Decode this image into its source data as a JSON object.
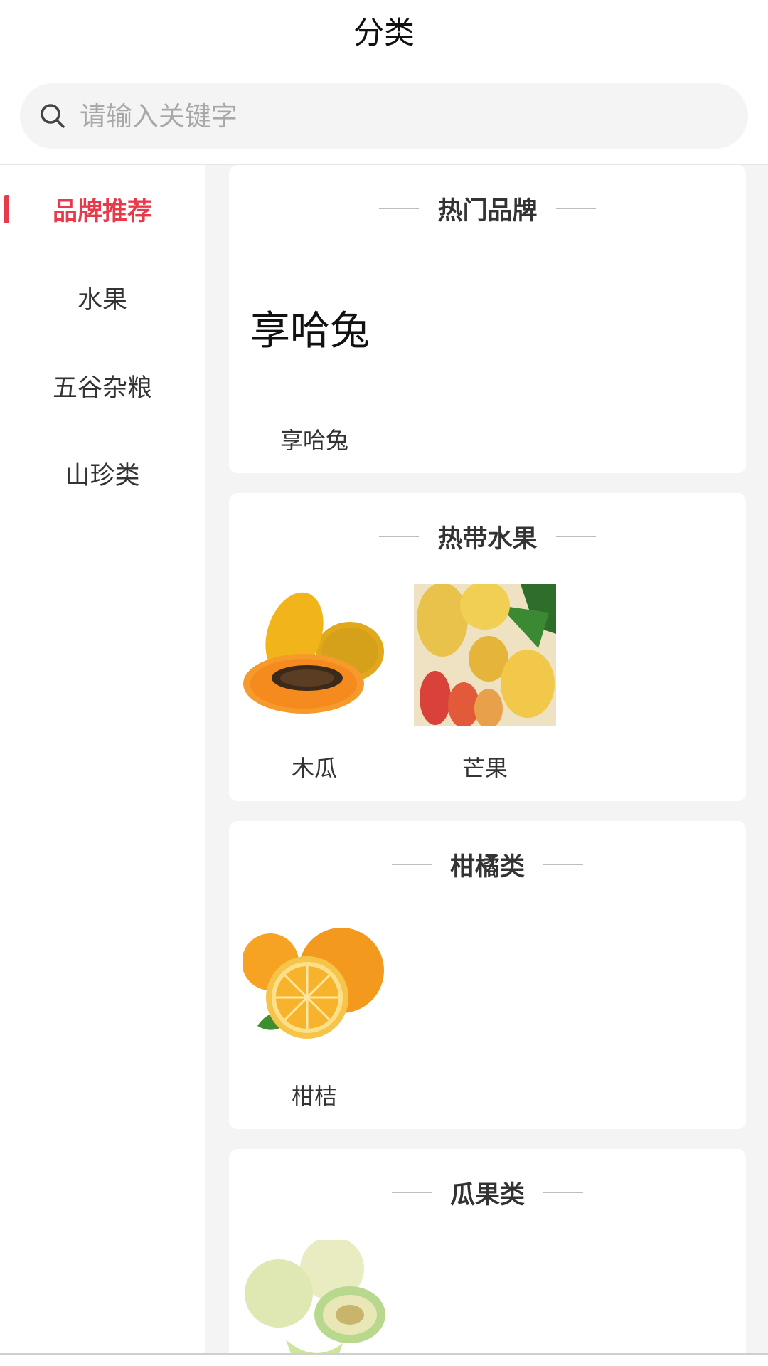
{
  "header": {
    "title": "分类"
  },
  "search": {
    "placeholder": "请输入关键字",
    "value": ""
  },
  "sidebar": {
    "items": [
      {
        "label": "品牌推荐",
        "active": true
      },
      {
        "label": "水果",
        "active": false
      },
      {
        "label": "五谷杂粮",
        "active": false
      },
      {
        "label": "山珍类",
        "active": false
      }
    ]
  },
  "sections": [
    {
      "title": "热门品牌",
      "items": [
        {
          "brand_logo_text": "享哈兔",
          "label": "享哈兔",
          "image": "brand-logo"
        }
      ]
    },
    {
      "title": "热带水果",
      "items": [
        {
          "label": "木瓜",
          "image": "papaya"
        },
        {
          "label": "芒果",
          "image": "mango"
        }
      ]
    },
    {
      "title": "柑橘类",
      "items": [
        {
          "label": "柑桔",
          "image": "orange"
        }
      ]
    },
    {
      "title": "瓜果类",
      "items": [
        {
          "label": "",
          "image": "melon"
        }
      ]
    }
  ],
  "colors": {
    "accent": "#e93a4b",
    "background": "#f4f4f4"
  }
}
